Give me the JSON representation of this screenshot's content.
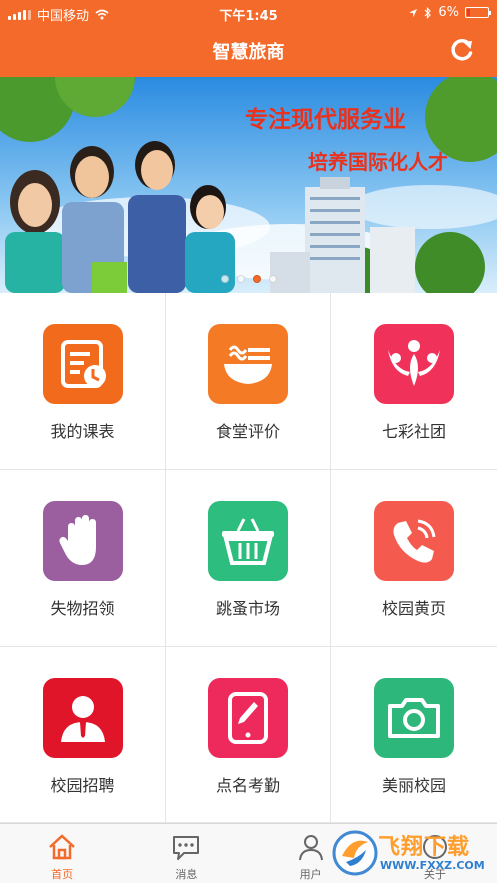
{
  "status_bar": {
    "carrier": "中国移动",
    "time": "下午1:45",
    "battery": "6%",
    "battery_level": 0.06
  },
  "header": {
    "title": "智慧旅商",
    "refresh_icon": "refresh-icon",
    "color": "#f46a2a"
  },
  "banner": {
    "slogan_line1": "专注现代服务业",
    "slogan_line2": "培养国际化人才",
    "slide_count": 4,
    "active_slide": 3
  },
  "grid": {
    "items": [
      {
        "label": "我的课表",
        "icon": "schedule-icon",
        "color": "#f26b1d"
      },
      {
        "label": "食堂评价",
        "icon": "canteen-bowl-icon",
        "color": "#f47a26"
      },
      {
        "label": "七彩社团",
        "icon": "club-people-icon",
        "color": "#f0325a"
      },
      {
        "label": "失物招领",
        "icon": "hand-icon",
        "color": "#9b5fa0"
      },
      {
        "label": "跳蚤市场",
        "icon": "basket-icon",
        "color": "#2dbd7e"
      },
      {
        "label": "校园黄页",
        "icon": "phone-icon",
        "color": "#f55a4e"
      },
      {
        "label": "校园招聘",
        "icon": "person-icon",
        "color": "#e0152a"
      },
      {
        "label": "点名考勤",
        "icon": "tablet-pen-icon",
        "color": "#ee2a5c"
      },
      {
        "label": "美丽校园",
        "icon": "camera-icon",
        "color": "#2db77a"
      }
    ]
  },
  "tabbar": {
    "tabs": [
      {
        "label": "首页",
        "icon": "home-icon",
        "active": true
      },
      {
        "label": "消息",
        "icon": "message-icon",
        "active": false
      },
      {
        "label": "用户",
        "icon": "user-icon",
        "active": false
      },
      {
        "label": "关于",
        "icon": "about-icon",
        "active": false
      }
    ]
  },
  "watermark": {
    "text": "飞翔下载",
    "url": "WWW.FXXZ.COM"
  }
}
